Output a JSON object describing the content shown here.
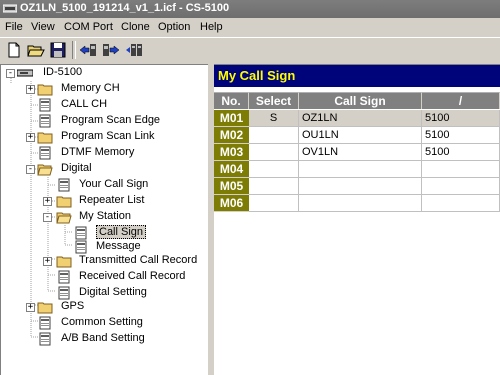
{
  "window": {
    "title": "OZ1LN_5100_191214_v1_1.icf - CS-5100"
  },
  "menu": [
    "File",
    "View",
    "COM Port",
    "Clone",
    "Option",
    "Help"
  ],
  "toolbar": [
    "new-file-icon",
    "open-folder-icon",
    "save-icon",
    "read-from-radio-icon",
    "write-to-radio-icon",
    "clone-icon"
  ],
  "tree": {
    "root": "ID-5100",
    "items": [
      {
        "label": "Memory CH",
        "icon": "folder-icon",
        "expander": "+"
      },
      {
        "label": "CALL CH",
        "icon": "page-icon",
        "expander": ""
      },
      {
        "label": "Program Scan Edge",
        "icon": "page-icon",
        "expander": ""
      },
      {
        "label": "Program Scan Link",
        "icon": "folder-icon",
        "expander": "+"
      },
      {
        "label": "DTMF Memory",
        "icon": "page-icon",
        "expander": ""
      },
      {
        "label": "Digital",
        "icon": "open-folder-icon",
        "expander": "-"
      },
      {
        "label": "Your Call Sign",
        "icon": "page-icon",
        "expander": ""
      },
      {
        "label": "Repeater List",
        "icon": "folder-icon",
        "expander": "+"
      },
      {
        "label": "My Station",
        "icon": "open-folder-icon",
        "expander": "-"
      },
      {
        "label": "Call Sign",
        "icon": "page-icon",
        "expander": ""
      },
      {
        "label": "Message",
        "icon": "page-icon",
        "expander": ""
      },
      {
        "label": "Transmitted Call Record",
        "icon": "folder-icon",
        "expander": "+"
      },
      {
        "label": "Received Call Record",
        "icon": "page-icon",
        "expander": ""
      },
      {
        "label": "Digital Setting",
        "icon": "page-icon",
        "expander": ""
      },
      {
        "label": "GPS",
        "icon": "folder-icon",
        "expander": "+"
      },
      {
        "label": "Common Setting",
        "icon": "page-icon",
        "expander": ""
      },
      {
        "label": "A/B Band Setting",
        "icon": "page-icon",
        "expander": ""
      }
    ]
  },
  "panel": {
    "title": "My Call Sign",
    "columns": [
      "No.",
      "Select",
      "Call Sign",
      "/"
    ],
    "rows": [
      {
        "no": "M01",
        "select": "S",
        "callsign": "OZ1LN",
        "suffix": "5100"
      },
      {
        "no": "M02",
        "select": "",
        "callsign": "OU1LN",
        "suffix": "5100"
      },
      {
        "no": "M03",
        "select": "",
        "callsign": "OV1LN",
        "suffix": "5100"
      },
      {
        "no": "M04",
        "select": "",
        "callsign": "",
        "suffix": ""
      },
      {
        "no": "M05",
        "select": "",
        "callsign": "",
        "suffix": ""
      },
      {
        "no": "M06",
        "select": "",
        "callsign": "",
        "suffix": ""
      }
    ]
  },
  "colors": {
    "panel_title_bg": "#00047a",
    "panel_title_fg": "#ffff00",
    "row_header_bg": "#7d7d05",
    "selected_row_bg": "#d4d0c8"
  }
}
